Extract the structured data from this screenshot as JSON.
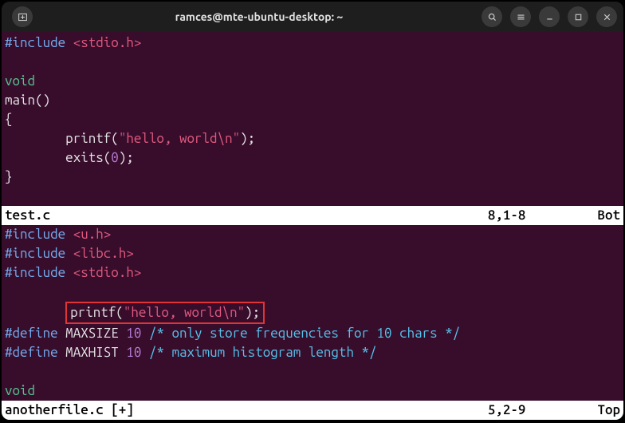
{
  "titlebar": {
    "title": "ramces@mte-ubuntu-desktop: ~"
  },
  "pane1": {
    "lines": {
      "l1_pre": "#include",
      "l1_str": "<stdio.h>",
      "l3_type": "void",
      "l4_fn": "main()",
      "l5_brace": "{",
      "l6_indent": "        ",
      "l6_fn": "printf(",
      "l6_str": "\"hello, world\\n\"",
      "l6_close": ");",
      "l7_indent": "        ",
      "l7_fn": "exits(",
      "l7_num": "0",
      "l7_close": ");",
      "l8_brace": "}"
    },
    "status": {
      "file": "test.c",
      "pos": "8,1-8",
      "scroll": "Bot"
    }
  },
  "pane2": {
    "lines": {
      "l1_pre": "#include",
      "l1_str": "<u.h>",
      "l2_pre": "#include",
      "l2_str": "<libc.h>",
      "l3_pre": "#include",
      "l3_str": "<stdio.h>",
      "l5_indent": "        ",
      "l5_fn": "printf(",
      "l5_str": "\"hello, world\\n\"",
      "l5_close": ");",
      "l6_def": "#define",
      "l6_name": "MAXSIZE",
      "l6_num": "10",
      "l6_comm": "/* only store frequencies for 10 chars */",
      "l7_def": "#define",
      "l7_name": "MAXHIST",
      "l7_num": "10",
      "l7_comm": "/* maximum histogram length */",
      "l9_type": "void"
    },
    "status": {
      "file": "anotherfile.c [+]",
      "pos": "5,2-9",
      "scroll": "Top"
    }
  }
}
